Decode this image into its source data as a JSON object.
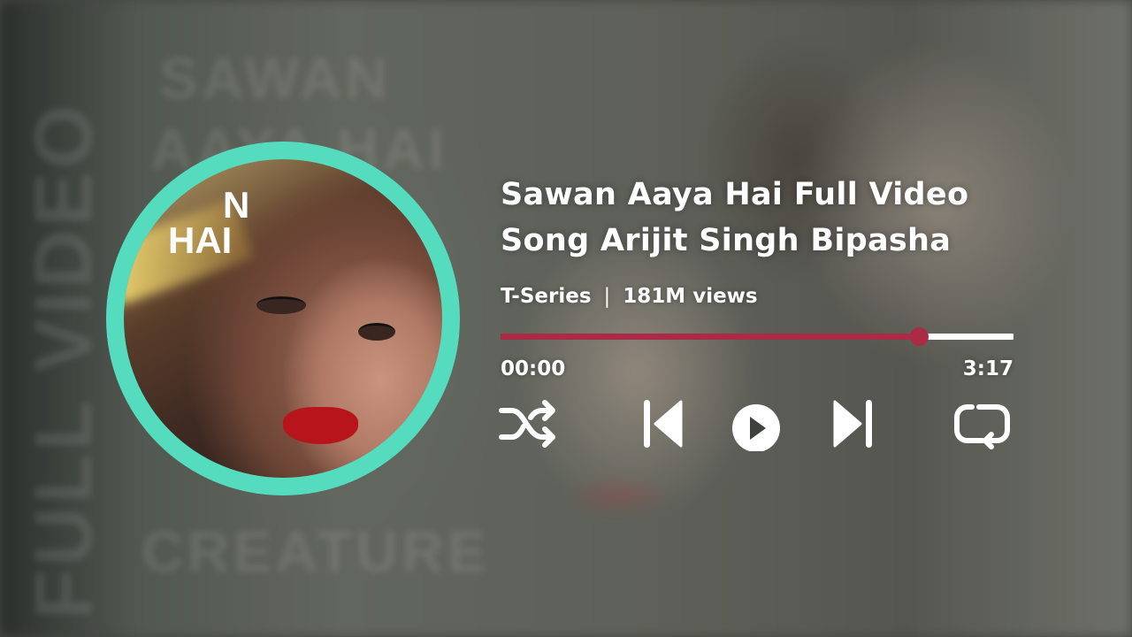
{
  "background": {
    "vertical_text": "FULL VIDEO",
    "blurred_text_1": "SAWAN",
    "blurred_text_2": "AAYA HAI",
    "blurred_text_3": "CREATURE"
  },
  "album_art": {
    "text_line_1": "N",
    "text_line_2": "HAI",
    "ring_color": "#55dcbf"
  },
  "track": {
    "title": "Sawan Aaya Hai Full Video Song Arijit Singh Bipasha",
    "channel": "T-Series",
    "separator": "|",
    "views": "181M views"
  },
  "playback": {
    "current_time": "00:00",
    "total_time": "3:17",
    "progress_fraction": 0.815,
    "accent_color": "#ab2b47"
  },
  "controls": {
    "shuffle_icon": "shuffle-icon",
    "previous_icon": "skip-previous-icon",
    "play_icon": "play-icon",
    "next_icon": "skip-next-icon",
    "repeat_icon": "repeat-icon"
  }
}
